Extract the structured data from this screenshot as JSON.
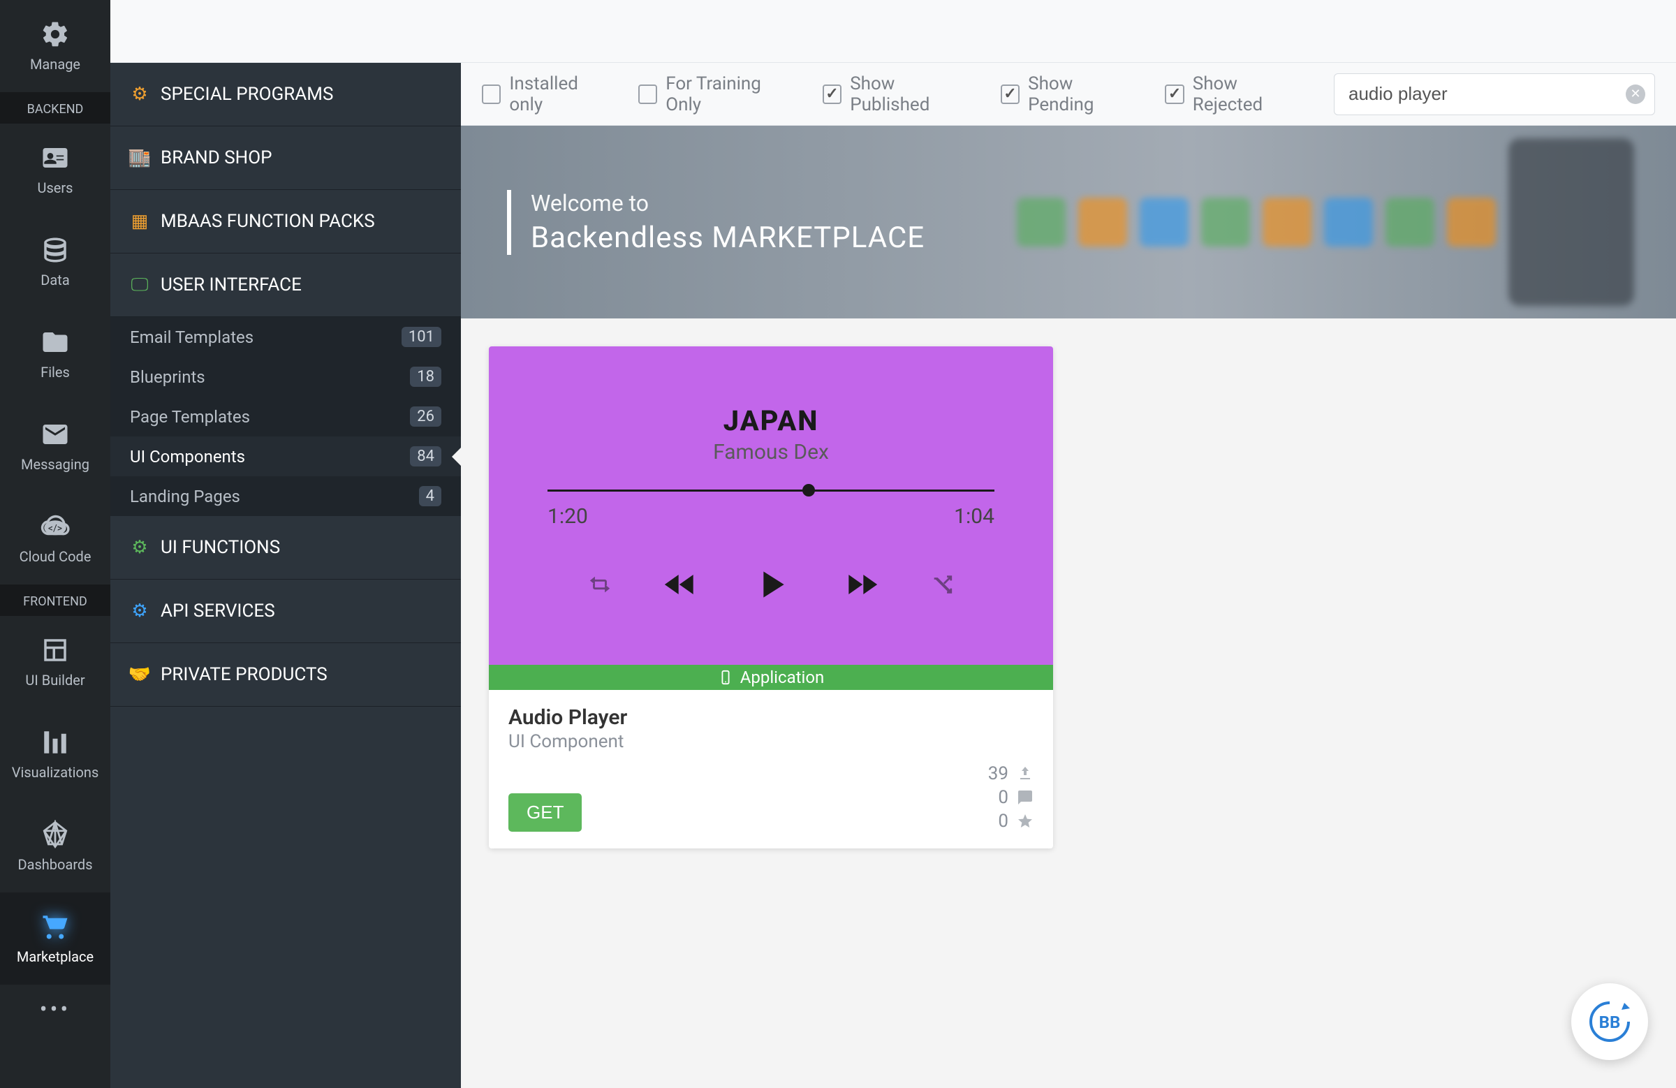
{
  "page": {
    "title": "Marketplace"
  },
  "icon_nav": {
    "backend_label": "BACKEND",
    "frontend_label": "FRONTEND",
    "items": [
      {
        "label": "Manage"
      },
      {
        "label": "Users"
      },
      {
        "label": "Data"
      },
      {
        "label": "Files"
      },
      {
        "label": "Messaging"
      },
      {
        "label": "Cloud Code"
      },
      {
        "label": "UI Builder"
      },
      {
        "label": "Visualizations"
      },
      {
        "label": "Dashboards"
      },
      {
        "label": "Marketplace"
      }
    ]
  },
  "side": {
    "categories": [
      {
        "label": "SPECIAL PROGRAMS"
      },
      {
        "label": "BRAND SHOP"
      },
      {
        "label": "MBAAS FUNCTION PACKS"
      },
      {
        "label": "USER INTERFACE"
      },
      {
        "label": "UI FUNCTIONS"
      },
      {
        "label": "API SERVICES"
      },
      {
        "label": "PRIVATE PRODUCTS"
      }
    ],
    "ui_items": [
      {
        "label": "Email Templates",
        "count": "101"
      },
      {
        "label": "Blueprints",
        "count": "18"
      },
      {
        "label": "Page Templates",
        "count": "26"
      },
      {
        "label": "UI Components",
        "count": "84"
      },
      {
        "label": "Landing Pages",
        "count": "4"
      }
    ]
  },
  "filters": {
    "installed_only": "Installed only",
    "training_only": "For Training Only",
    "show_published": "Show Published",
    "show_pending": "Show Pending",
    "show_rejected": "Show Rejected"
  },
  "search": {
    "value": "audio player"
  },
  "hero": {
    "welcome": "Welcome to",
    "title": "Backendless MARKETPLACE"
  },
  "product": {
    "track_title": "JAPAN",
    "track_artist": "Famous Dex",
    "time_elapsed": "1:20",
    "time_remaining": "1:04",
    "tag": "Application",
    "title": "Audio Player",
    "subtitle": "UI Component",
    "get": "GET",
    "stats": {
      "downloads": "39",
      "comments": "0",
      "stars": "0"
    }
  },
  "fab": {
    "label": "BB"
  }
}
